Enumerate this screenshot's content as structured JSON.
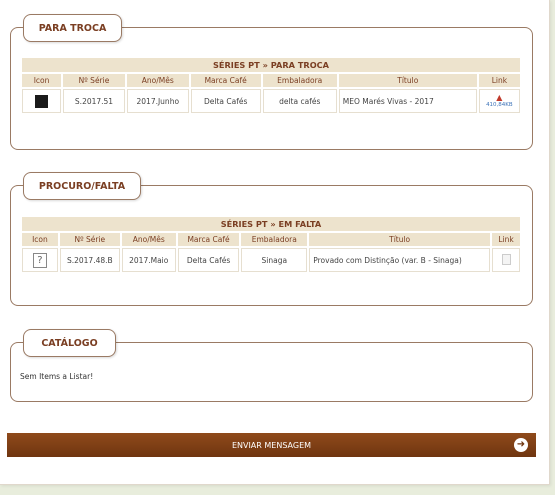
{
  "troca": {
    "legend": "PARA TROCA",
    "table_title": "SÉRIES PT » PARA TROCA",
    "columns": [
      "Icon",
      "Nº Série",
      "Ano/Mês",
      "Marca Café",
      "Embaladora",
      "Título",
      "Link"
    ],
    "row": {
      "serie": "S.2017.51",
      "ano": "2017.Junho",
      "marca": "Delta Cafés",
      "embaladora": "delta cafés",
      "titulo": "MEO Marés Vivas - 2017",
      "link": "410,84KB"
    }
  },
  "falta": {
    "legend": "PROCURO/FALTA",
    "table_title": "SÉRIES PT » EM FALTA",
    "columns": [
      "Icon",
      "Nº Série",
      "Ano/Mês",
      "Marca Café",
      "Embaladora",
      "Título",
      "Link"
    ],
    "row": {
      "icon": "?",
      "serie": "S.2017.48.B",
      "ano": "2017.Maio",
      "marca": "Delta Cafés",
      "embaladora": "Sinaga",
      "titulo": "Provado com Distinção (var. B - Sinaga)"
    }
  },
  "catalogo": {
    "legend": "CATÁLOGO",
    "empty_text": "Sem Items a Listar!"
  },
  "send_button": "ENVIAR MENSAGEM",
  "icons": {
    "thumb": "coffee-packet-thumbnail",
    "pdf": "pdf-icon",
    "doc": "document-icon",
    "arrow": "arrow-right-circle-icon"
  },
  "colors": {
    "accent": "#7a3e22",
    "header_bg": "#ede3cd",
    "button": "#7f4016"
  }
}
